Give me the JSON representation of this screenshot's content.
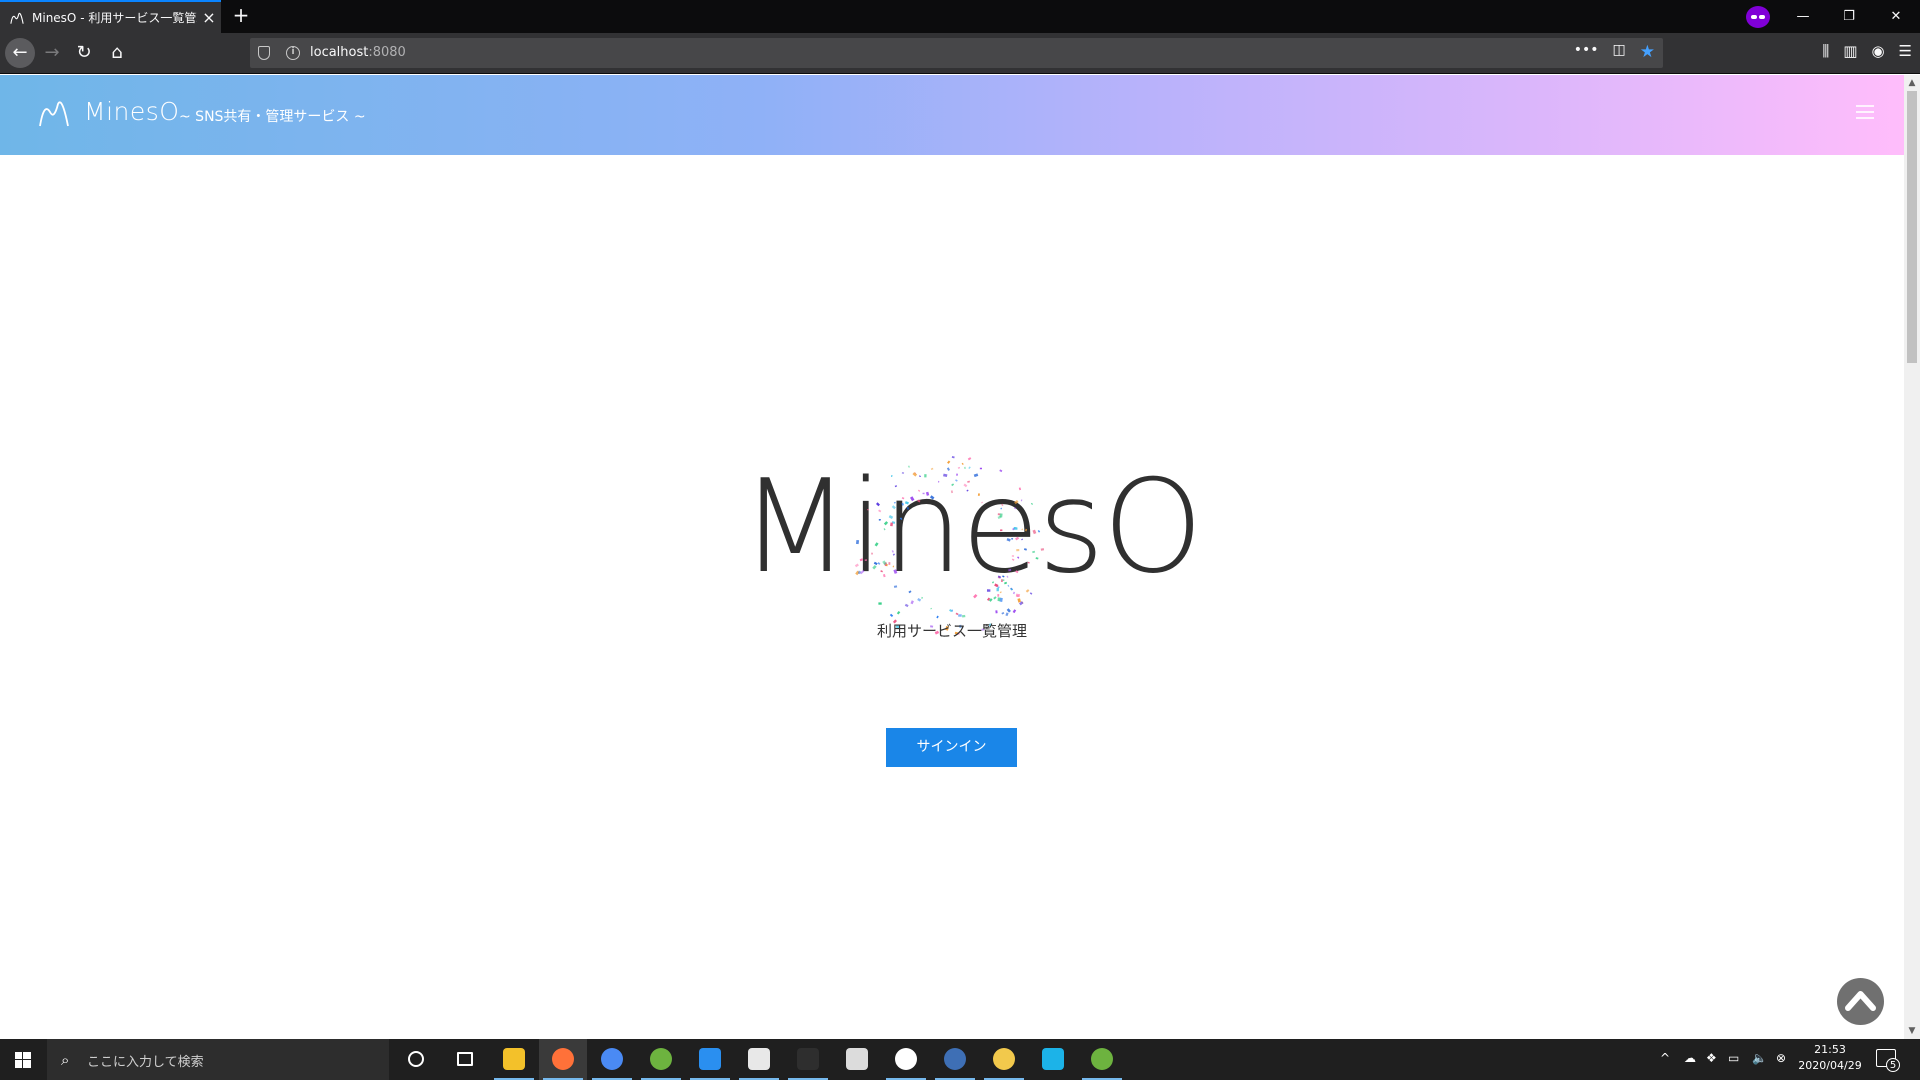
{
  "browser": {
    "tab_title": "MinesO - 利用サービス一覧管理",
    "tab_close": "×",
    "new_tab": "+",
    "url_host": "localhost",
    "url_port": ":8080",
    "url_more": "•••",
    "win_minimize": "—",
    "win_restore": "❐",
    "win_close": "✕"
  },
  "site": {
    "brand_name": "MinesO",
    "tagline": "~ SNS共有・管理サービス ~",
    "hero_title": "MinesO",
    "hero_subtitle": "利用サービス一覧管理",
    "signin_label": "サインイン"
  },
  "taskbar": {
    "search_placeholder": "ここに入力して検索",
    "time": "21:53",
    "date": "2020/04/29",
    "notification_count": "5",
    "apps": [
      {
        "name": "cortana",
        "color": "#1f1f1f"
      },
      {
        "name": "task-view",
        "color": "#1f1f1f"
      },
      {
        "name": "file-explorer",
        "color": "#f3c12a"
      },
      {
        "name": "firefox",
        "color": "#ff7139"
      },
      {
        "name": "chrome",
        "color": "#4a8af4"
      },
      {
        "name": "spring-tool-suite",
        "color": "#6db33f"
      },
      {
        "name": "vscode",
        "color": "#2a8ff0"
      },
      {
        "name": "typora",
        "color": "#e8e8e8"
      },
      {
        "name": "kotlin-ide",
        "color": "#2e2e2e"
      },
      {
        "name": "notepad",
        "color": "#dcdcdc"
      },
      {
        "name": "slack",
        "color": "#ffffff"
      },
      {
        "name": "keepass",
        "color": "#3e6fb5"
      },
      {
        "name": "clock-app",
        "color": "#f2c94c"
      },
      {
        "name": "azure-storage",
        "color": "#1cb3e8"
      },
      {
        "name": "spring-boot",
        "color": "#6db33f"
      }
    ]
  },
  "colors": {
    "accent": "#1a86e8",
    "header_gradient_start": "#6fb6e8",
    "header_gradient_end": "#ffbdfb"
  }
}
